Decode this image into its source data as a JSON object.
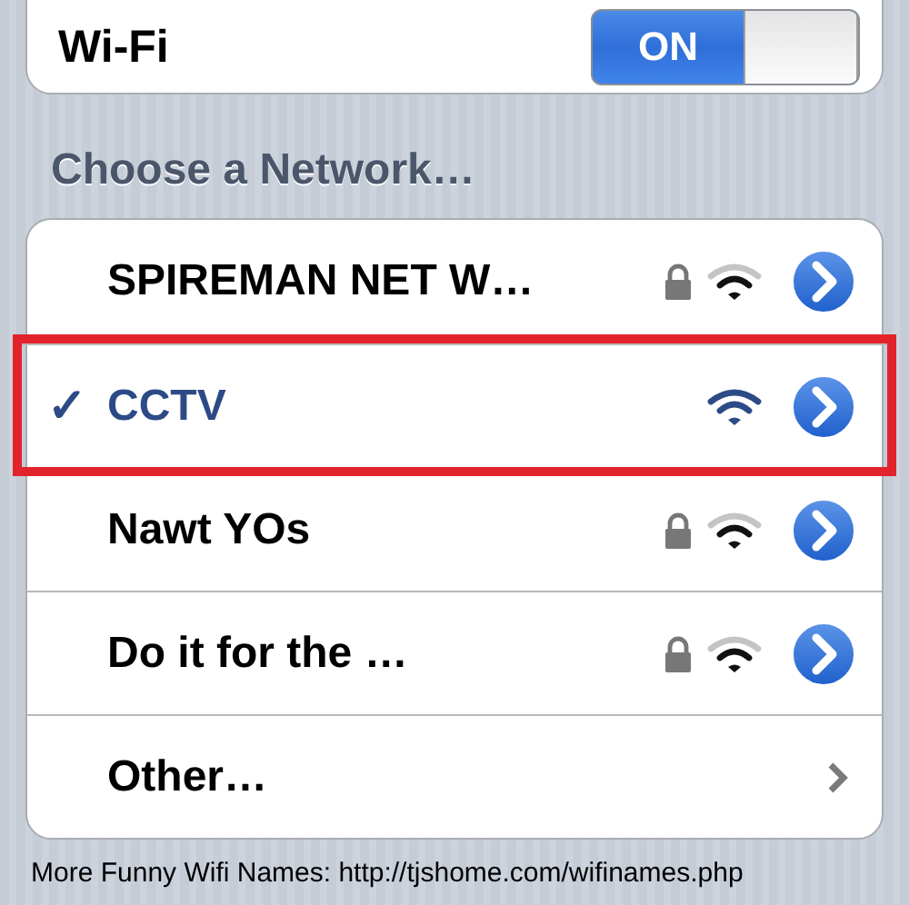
{
  "wifi": {
    "label": "Wi-Fi",
    "on": true,
    "on_text": "ON"
  },
  "section_title": "Choose a Network…",
  "networks": [
    {
      "kind": "network",
      "name": "SPIREMAN NET W…",
      "selected": false,
      "locked": true,
      "highlighted": false
    },
    {
      "kind": "network",
      "name": "CCTV",
      "check": "✓",
      "selected": true,
      "locked": false,
      "highlighted": true
    },
    {
      "kind": "network",
      "name": "Nawt YOs",
      "selected": false,
      "locked": true,
      "highlighted": false
    },
    {
      "kind": "network",
      "name": "Do it for the …",
      "selected": false,
      "locked": true,
      "highlighted": false
    },
    {
      "kind": "other",
      "name": "Other…"
    }
  ],
  "footer": "More Funny Wifi Names: http://tjshome.com/wifinames.php"
}
